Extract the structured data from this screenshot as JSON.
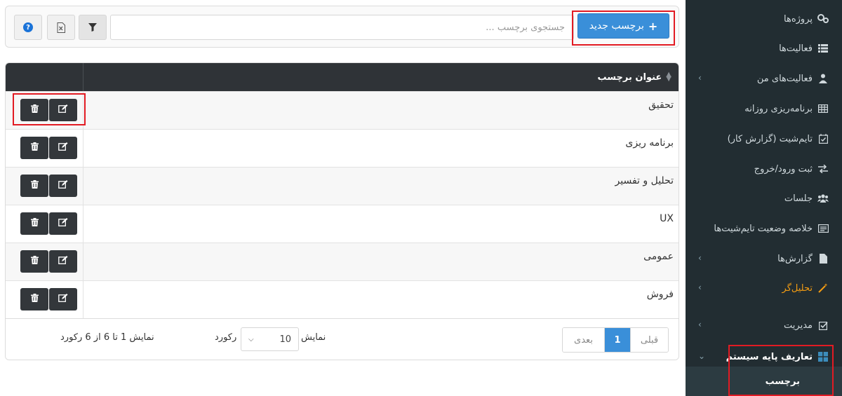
{
  "toolbar": {
    "new_button_label": "برچسب جدید",
    "new_button_icon": "plus-icon",
    "search_placeholder": "جستجوی برچسب ...",
    "search_value": "",
    "filter_icon": "filter-icon",
    "excel_icon": "excel-file-icon",
    "help_icon": "help-icon"
  },
  "table": {
    "column_title": "عنوان برچسب",
    "rows": [
      {
        "title": "تحقیق"
      },
      {
        "title": "برنامه ریزی"
      },
      {
        "title": "تحلیل و تفسیر"
      },
      {
        "title": "UX"
      },
      {
        "title": "عمومی"
      },
      {
        "title": "فروش"
      }
    ],
    "edit_icon": "edit-icon",
    "delete_icon": "trash-icon"
  },
  "footer": {
    "prev_label": "قبلی",
    "current_page": "1",
    "next_label": "بعدی",
    "show_label": "نمایش",
    "page_size": "10",
    "record_label": "رکورد",
    "info_text": "نمایش 1 تا 6 از 6 رکورد"
  },
  "sidebar": {
    "items": [
      {
        "label": "پروژه‌ها",
        "icon": "projects-icon"
      },
      {
        "label": "فعالیت‌ها",
        "icon": "list-icon"
      },
      {
        "label": "فعالیت‌های من",
        "icon": "user-tasks-icon"
      },
      {
        "label": "برنامه‌ریزی روزانه",
        "icon": "grid-icon"
      },
      {
        "label": "تایم‌شیت (گزارش کار)",
        "icon": "calendar-check-icon"
      },
      {
        "label": "ثبت ورود/خروج",
        "icon": "exchange-icon"
      },
      {
        "label": "جلسات",
        "icon": "users-icon"
      },
      {
        "label": "خلاصه وضعیت تایم‌شیت‌ها",
        "icon": "id-card-icon"
      },
      {
        "label": "گزارش‌ها",
        "icon": "file-icon"
      },
      {
        "label": "تحلیل‌گر",
        "icon": "magic-wand-icon"
      },
      {
        "label": "مدیریت",
        "icon": "checkbox-icon"
      },
      {
        "label": "تعاریف پایه سیستم",
        "icon": "windows-icon"
      }
    ],
    "sub_item": "برچسب",
    "active_color": "#f39c12"
  },
  "colors": {
    "primary": "#3a8fd9",
    "sidebar_bg": "#222d32",
    "table_header_bg": "#2f3337",
    "highlight": "#e21b23"
  }
}
